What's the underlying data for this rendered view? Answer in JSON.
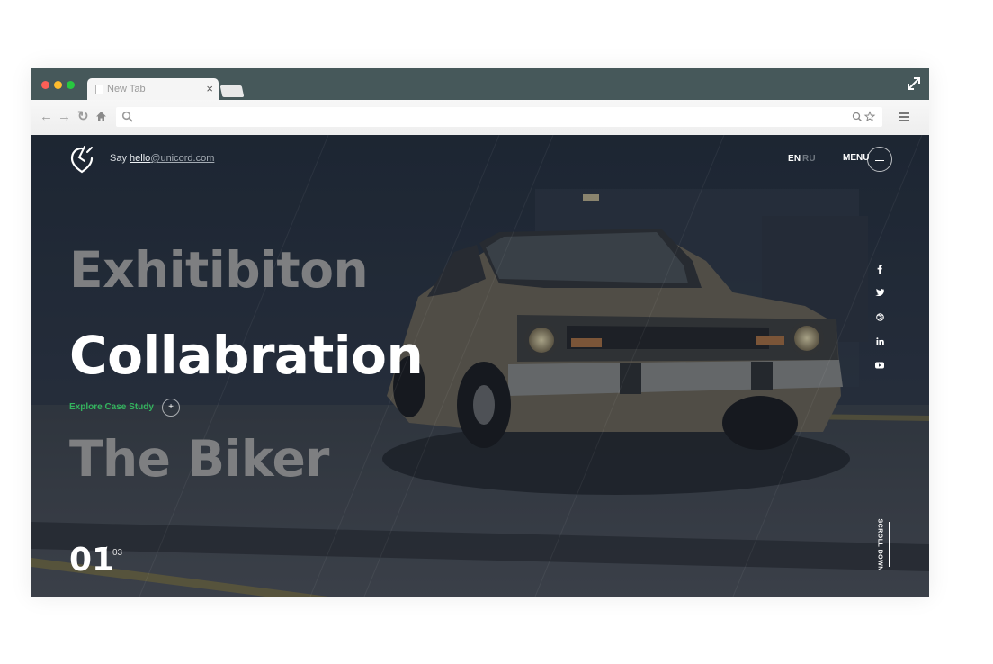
{
  "browser": {
    "tab_title": "New Tab"
  },
  "header": {
    "say_prefix": "Say",
    "email_user": "hello",
    "email_domain": "@unicord.com",
    "lang_en": "EN",
    "lang_ru": "RU",
    "menu_label": "MENU"
  },
  "hero": {
    "slide_prev": "Exhitibiton",
    "slide_current": "Collabration",
    "explore_label": "Explore Case Study",
    "slide_next": "The Biker",
    "counter_current": "01",
    "counter_separator": "/",
    "counter_total": "03",
    "scroll_label": "SCROLL DOWN"
  },
  "social": [
    "facebook-icon",
    "twitter-icon",
    "dribbble-icon",
    "linkedin-icon",
    "youtube-icon"
  ],
  "colors": {
    "accent_green": "#33b35f",
    "titlebar": "#46585a",
    "hero_dark": "#26303d"
  }
}
